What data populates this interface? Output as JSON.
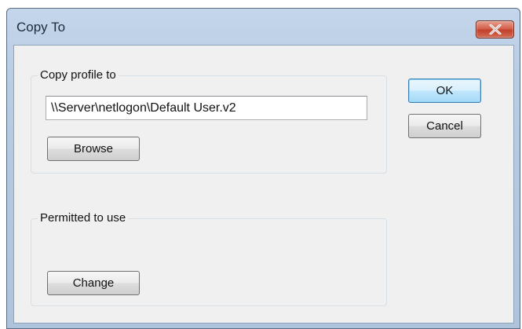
{
  "window": {
    "title": "Copy To",
    "close_icon": "close-icon",
    "close_color": "#c9432e"
  },
  "copy_profile": {
    "group_label": "Copy profile to",
    "path_value": "\\\\Server\\netlogon\\Default User.v2",
    "browse_label": "Browse"
  },
  "permitted": {
    "group_label": "Permitted to use",
    "change_label": "Change"
  },
  "actions": {
    "ok_label": "OK",
    "cancel_label": "Cancel"
  }
}
